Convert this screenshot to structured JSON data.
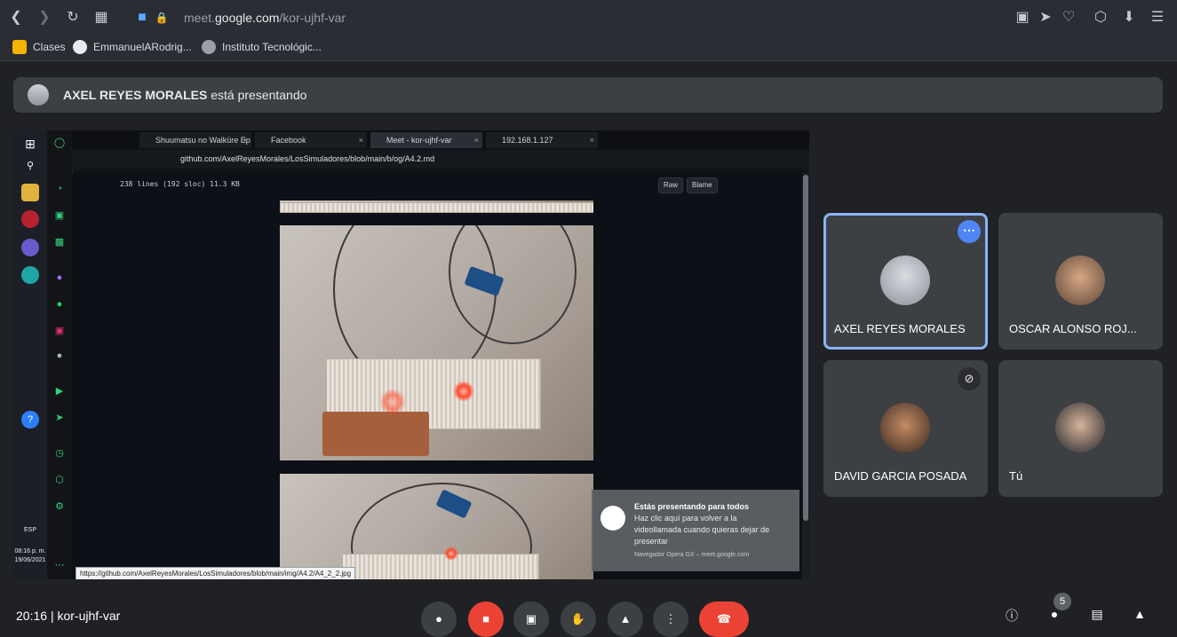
{
  "browser": {
    "url_prefix": "meet.",
    "url_domain": "google.com",
    "url_path": "/kor-ujhf-var",
    "bookmarks": [
      {
        "label": "Clases",
        "icon": "classroom-icon"
      },
      {
        "label": "EmmanuelARodrig...",
        "icon": "github-icon"
      },
      {
        "label": "Instituto Tecnológic...",
        "icon": "institute-icon"
      }
    ]
  },
  "banner": {
    "presenter": "AXEL REYES MORALES",
    "suffix": " está presentando"
  },
  "shared_screen": {
    "tabs": [
      {
        "label": "Shuumatsu no Walküre Ep"
      },
      {
        "label": "Facebook"
      },
      {
        "label": "Meet - kor-ujhf-var"
      },
      {
        "label": "192.168.1.127"
      }
    ],
    "address": "github.com/AxelReyesMorales/LosSimuladores/blob/main/b/og/A4.2.md",
    "file_meta": "238 lines (192 sloc)   11.3 KB",
    "raw_label": "Raw",
    "blame_label": "Blame",
    "status_url": "https://github.com/AxelReyesMorales/LosSimuladores/blob/main/img/A4.2/A4_2_2.jpg",
    "clock_time": "08:16 p. m.",
    "clock_date": "19/06/2021",
    "lang": "ESP",
    "notification": {
      "title": "Estás presentando para todos",
      "body": "Haz clic aquí para volver a la videollamada cuando quieras dejar de presentar",
      "footer": "Navegador Opera GX – meet.google.com"
    }
  },
  "participants": [
    {
      "name": "AXEL REYES MORALES",
      "active": true
    },
    {
      "name": "OSCAR ALONSO ROJ...",
      "active": false
    },
    {
      "name": "DAVID GARCIA POSADA",
      "active": false,
      "muted": true
    },
    {
      "name": "Tú",
      "active": false
    }
  ],
  "bottom": {
    "time": "20:16",
    "separator": "|",
    "meeting_code": "kor-ujhf-var",
    "people_count": "5"
  }
}
